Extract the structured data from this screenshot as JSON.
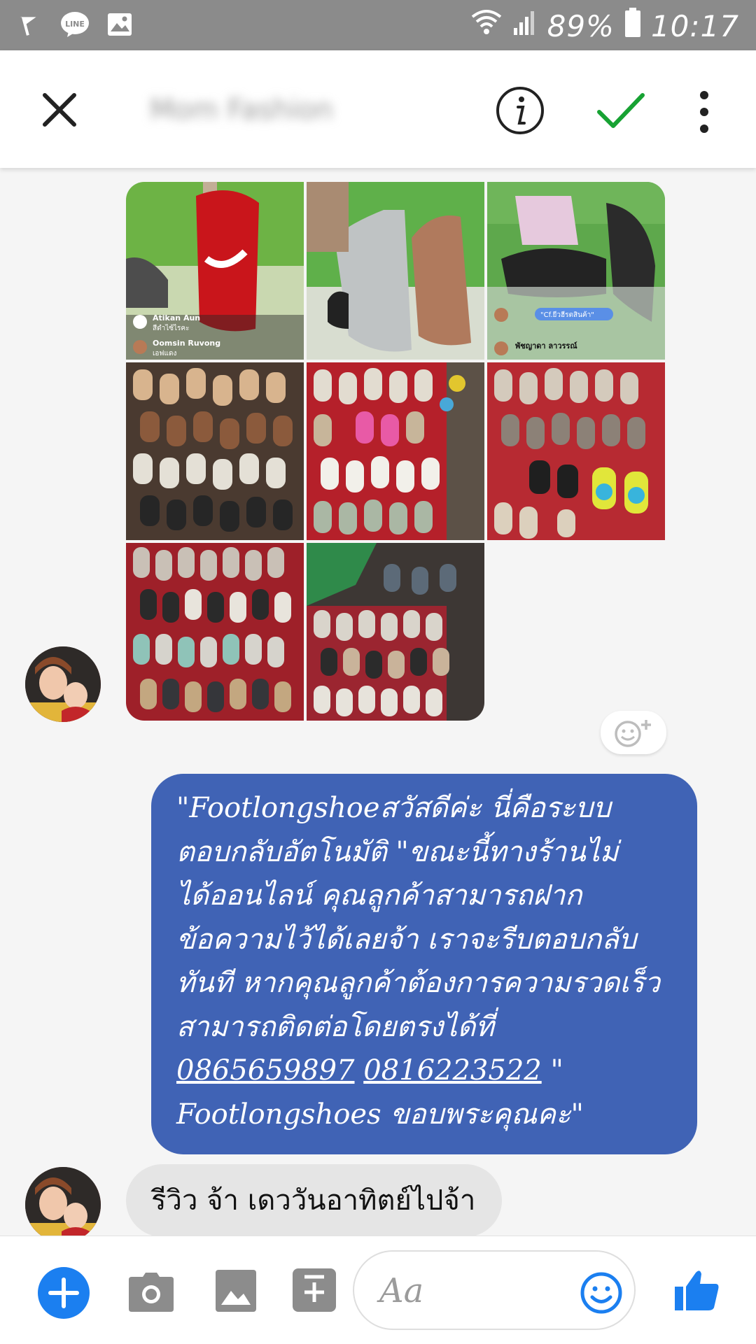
{
  "status_bar": {
    "battery": "89%",
    "time": "10:17"
  },
  "header": {
    "contact_name": "Mom Fashion"
  },
  "photos": [
    {
      "caption": "Atikan Aun",
      "subcaption": "สีดำไซ้ไรคะ"
    },
    {
      "caption": "",
      "subcaption": ""
    },
    {
      "caption": "พัชญาดา ลาวรรณ์",
      "subcaption": "\"Cf.ยีวฮีรตสินค้า\""
    },
    {
      "caption": "",
      "subcaption": ""
    },
    {
      "caption": "",
      "subcaption": ""
    },
    {
      "caption": "",
      "subcaption": ""
    },
    {
      "caption": "",
      "subcaption": ""
    },
    {
      "caption": "",
      "subcaption": ""
    }
  ],
  "photo_overlay": {
    "name2": "Oomsin Ruvong",
    "name2_sub": "เอฟแดง"
  },
  "messages": {
    "outgoing": {
      "line1": "\"Footlongshoeสวัสดีค่ะ นี่คือระบบ",
      "line2": "ตอบกลับอัตโนมัติ \"ขณะนี้ทางร้านไม่",
      "line3": "ได้ออนไลน์ คุณลูกค้าสามารถฝาก",
      "line4": "ข้อความไว้ได้เลยจ้า เราจะรีบตอบกลับ",
      "line5": "ทันที หากคุณลูกค้าต้องการความรวดเร็ว",
      "line6": "สามารถติดต่อโดยตรงได้ที่",
      "phone1": "0865659897",
      "phone2": "0816223522",
      "line7_suffix": "\"",
      "line8": "Footlongshoes ขอบพระคุณคะ\""
    },
    "incoming": "รีวิว จ้า เดววันอาทิตย์ไปจ้า"
  },
  "composer": {
    "placeholder": "Aa"
  },
  "colors": {
    "outgoing_bubble": "#4063b5",
    "incoming_bubble": "#e5e5e5",
    "accent": "#1b7ff0",
    "check": "#17a233"
  }
}
